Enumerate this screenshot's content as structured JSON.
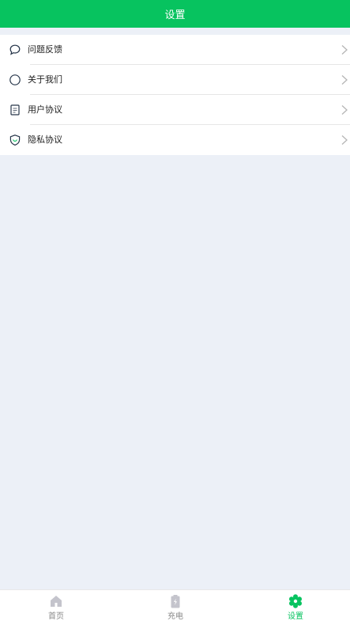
{
  "header": {
    "title": "设置"
  },
  "menu": [
    {
      "label": "问题反馈",
      "icon": "chat-bubble-icon"
    },
    {
      "label": "关于我们",
      "icon": "circle-icon"
    },
    {
      "label": "用户协议",
      "icon": "document-icon"
    },
    {
      "label": "隐私协议",
      "icon": "shield-icon"
    }
  ],
  "tabs": [
    {
      "label": "首页",
      "icon": "home-icon",
      "active": false
    },
    {
      "label": "充电",
      "icon": "battery-charge-icon",
      "active": false
    },
    {
      "label": "设置",
      "icon": "gear-icon",
      "active": true
    }
  ],
  "colors": {
    "accent": "#07c35f",
    "background": "#ecf0f7",
    "inactive": "#8a8a8a"
  }
}
